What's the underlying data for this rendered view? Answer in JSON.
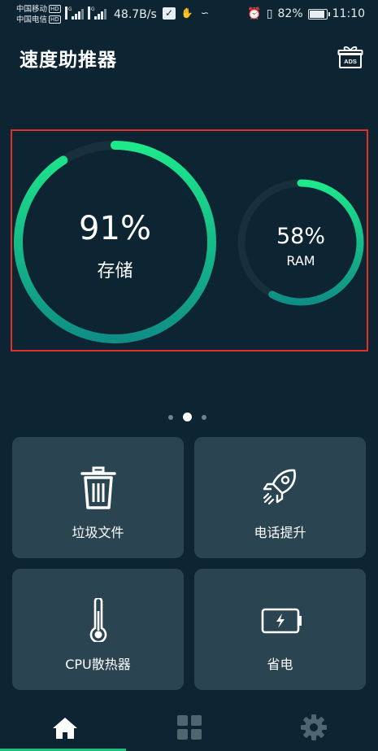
{
  "status_bar": {
    "carrier1": "中国移动",
    "carrier2": "中国电信",
    "hd_badge": "HD",
    "net_type": "4G",
    "net_speed": "48.7B/s",
    "battery": "82%",
    "time": "11:10"
  },
  "header": {
    "title": "速度助推器",
    "ads_badge": "ADS"
  },
  "gauges": {
    "storage": {
      "percent": 91,
      "value_text": "91%",
      "label": "存储"
    },
    "ram": {
      "percent": 58,
      "value_text": "58%",
      "label": "RAM"
    }
  },
  "pager": {
    "count": 3,
    "active_index": 1
  },
  "tiles": [
    {
      "label": "垃圾文件",
      "icon": "trash-icon"
    },
    {
      "label": "电话提升",
      "icon": "rocket-icon"
    },
    {
      "label": "CPU散热器",
      "icon": "thermometer-icon"
    },
    {
      "label": "省电",
      "icon": "battery-charge-icon"
    }
  ],
  "bottom_nav": [
    {
      "icon": "home-icon",
      "active": true
    },
    {
      "icon": "grid-icon",
      "active": false
    },
    {
      "icon": "gear-icon",
      "active": false
    }
  ],
  "colors": {
    "background": "#0d2433",
    "tile": "#2a4551",
    "accent_start": "#1de98b",
    "accent_end": "#0f8e86",
    "track": "#17303b",
    "nav_inactive": "#4f6670",
    "focus_frame": "#e0302a"
  }
}
